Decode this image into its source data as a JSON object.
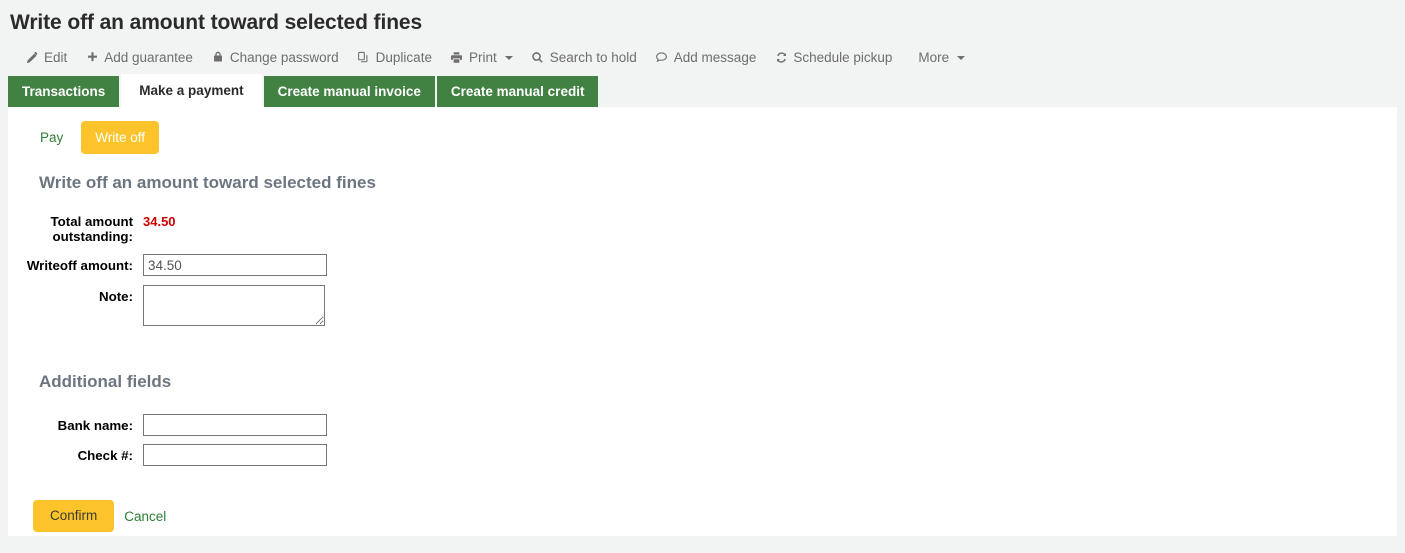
{
  "page": {
    "title": "Write off an amount toward selected fines"
  },
  "toolbar": {
    "items": [
      {
        "label": "Edit",
        "icon": "pencil-icon",
        "caret": false
      },
      {
        "label": "Add guarantee",
        "icon": "plus-icon",
        "caret": false
      },
      {
        "label": "Change password",
        "icon": "lock-icon",
        "caret": false
      },
      {
        "label": "Duplicate",
        "icon": "copy-icon",
        "caret": false
      },
      {
        "label": "Print",
        "icon": "printer-icon",
        "caret": true
      },
      {
        "label": "Search to hold",
        "icon": "search-icon",
        "caret": false
      },
      {
        "label": "Add message",
        "icon": "comment-icon",
        "caret": false
      },
      {
        "label": "Schedule pickup",
        "icon": "refresh-icon",
        "caret": false
      },
      {
        "label": "More",
        "icon": "",
        "caret": true
      }
    ]
  },
  "tabs": [
    {
      "label": "Transactions",
      "active": false
    },
    {
      "label": "Make a payment",
      "active": true
    },
    {
      "label": "Create manual invoice",
      "active": false
    },
    {
      "label": "Create manual credit",
      "active": false
    }
  ],
  "subnav": {
    "pay_label": "Pay",
    "writeoff_label": "Write off"
  },
  "form": {
    "heading": "Write off an amount toward selected fines",
    "total_label": "Total amount outstanding:",
    "total_value": "34.50",
    "writeoff_label": "Writeoff amount:",
    "writeoff_value": "34.50",
    "note_label": "Note:",
    "note_value": ""
  },
  "additional": {
    "heading": "Additional fields",
    "bank_label": "Bank name:",
    "bank_value": "",
    "check_label": "Check #:",
    "check_value": ""
  },
  "actions": {
    "confirm_label": "Confirm",
    "cancel_label": "Cancel"
  },
  "colors": {
    "tab_green": "#418141",
    "accent_yellow": "#fcc42a",
    "link_green": "#2d7e35",
    "alert_red": "#cc0000",
    "heading_gray": "#6c7680",
    "page_bg": "#f2f3f3"
  }
}
